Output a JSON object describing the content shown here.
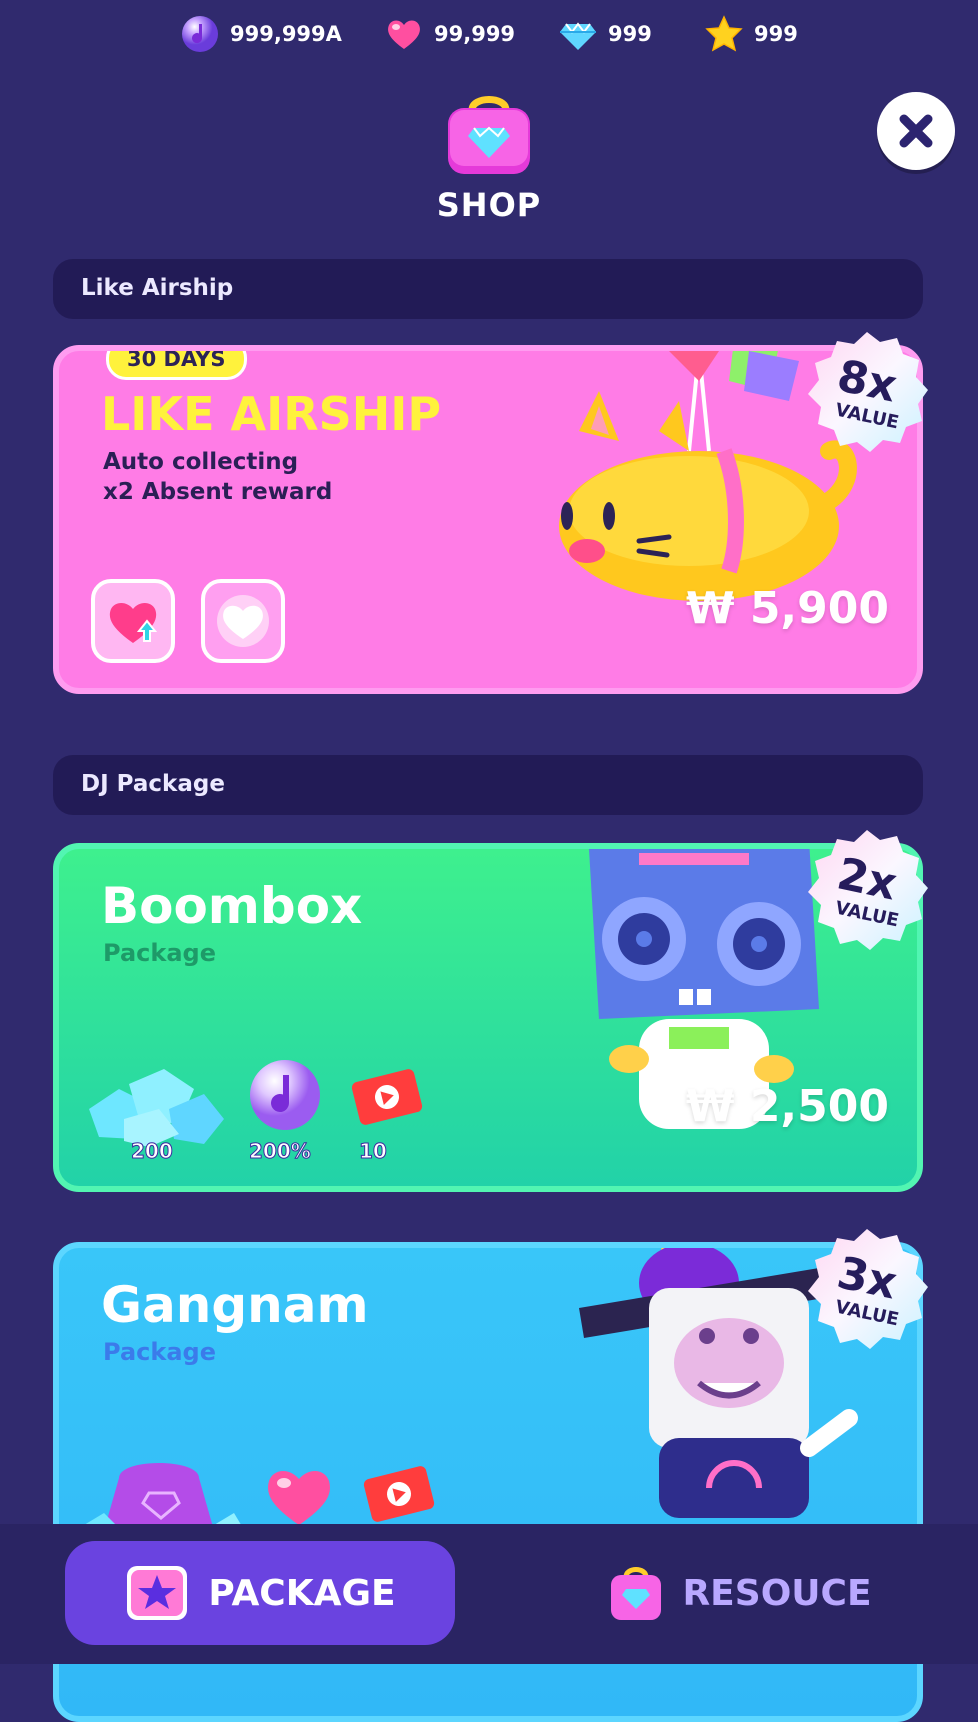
{
  "currencies": [
    {
      "icon": "music-orb-icon",
      "value": "999,999A"
    },
    {
      "icon": "heart-icon",
      "value": "99,999"
    },
    {
      "icon": "diamond-icon",
      "value": "999"
    },
    {
      "icon": "star-icon",
      "value": "999"
    }
  ],
  "header": {
    "title": "SHOP"
  },
  "sections": {
    "airship": {
      "label": "Like Airship"
    },
    "dj": {
      "label": "DJ Package"
    }
  },
  "cards": {
    "airship": {
      "badge": "30 DAYS",
      "title": "LIKE AIRSHIP",
      "desc_lines": [
        "Auto collecting",
        "x2 Absent reward"
      ],
      "price": "₩ 5,900",
      "value_multiplier": "8x",
      "value_label": "VALUE"
    },
    "boombox": {
      "title": "Boombox",
      "subtitle": "Package",
      "price": "₩ 2,500",
      "value_multiplier": "2x",
      "value_label": "VALUE",
      "items": [
        {
          "icon": "diamond-pile-icon",
          "count": "200"
        },
        {
          "icon": "music-orb-icon",
          "count": "200%"
        },
        {
          "icon": "ticket-icon",
          "count": "10"
        }
      ]
    },
    "gangnam": {
      "title": "Gangnam",
      "subtitle": "Package",
      "value_multiplier": "3x",
      "value_label": "VALUE"
    }
  },
  "tabs": {
    "package": "PACKAGE",
    "resouce": "RESOUCE"
  },
  "colors": {
    "background": "#302a6e",
    "airship_card": "#ff7ce6",
    "boombox_card": "#30e39a",
    "gangnam_card": "#36c0f8",
    "active_tab": "#6a43e0",
    "title_yellow": "#fff23c"
  }
}
